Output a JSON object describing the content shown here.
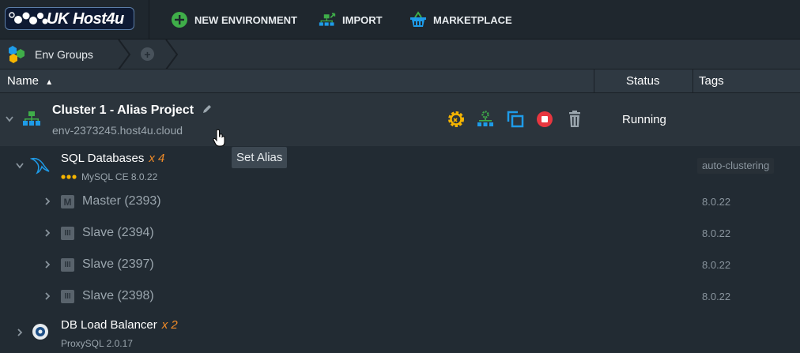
{
  "brand": {
    "logo_text": "UK Host4u"
  },
  "toolbar": {
    "new_environment": "NEW ENVIRONMENT",
    "import": "IMPORT",
    "marketplace": "MARKETPLACE"
  },
  "groups": {
    "label": "Env Groups",
    "add_symbol": "+"
  },
  "table": {
    "columns": {
      "name": "Name",
      "sort_indicator": "▲",
      "status": "Status",
      "tags": "Tags"
    }
  },
  "environment": {
    "title": "Cluster 1 - Alias Project",
    "domain": "env-2373245.host4u.cloud",
    "status": "Running",
    "tooltip": "Set Alias",
    "actions": [
      "settings-icon",
      "topology-icon",
      "clone-icon",
      "stop-icon",
      "delete-icon"
    ]
  },
  "layers": [
    {
      "title": "SQL Databases",
      "count": "x 4",
      "subtitle": "MySQL CE 8.0.22",
      "tag": "auto-clustering",
      "nodes": [
        {
          "icon_letter": "M",
          "label": "Master (2393)",
          "version": "8.0.22"
        },
        {
          "icon_letter": "III",
          "label": "Slave (2394)",
          "version": "8.0.22"
        },
        {
          "icon_letter": "III",
          "label": "Slave (2397)",
          "version": "8.0.22"
        },
        {
          "icon_letter": "III",
          "label": "Slave (2398)",
          "version": "8.0.22"
        }
      ]
    },
    {
      "title": "DB Load Balancer",
      "count": "x 2",
      "subtitle": "ProxySQL 2.0.17"
    }
  ],
  "colors": {
    "accent_orange": "#f28c28",
    "accent_green": "#3fae49",
    "accent_blue": "#1e9be8",
    "stop_red": "#e8363f",
    "gear_yellow": "#f5b400"
  }
}
